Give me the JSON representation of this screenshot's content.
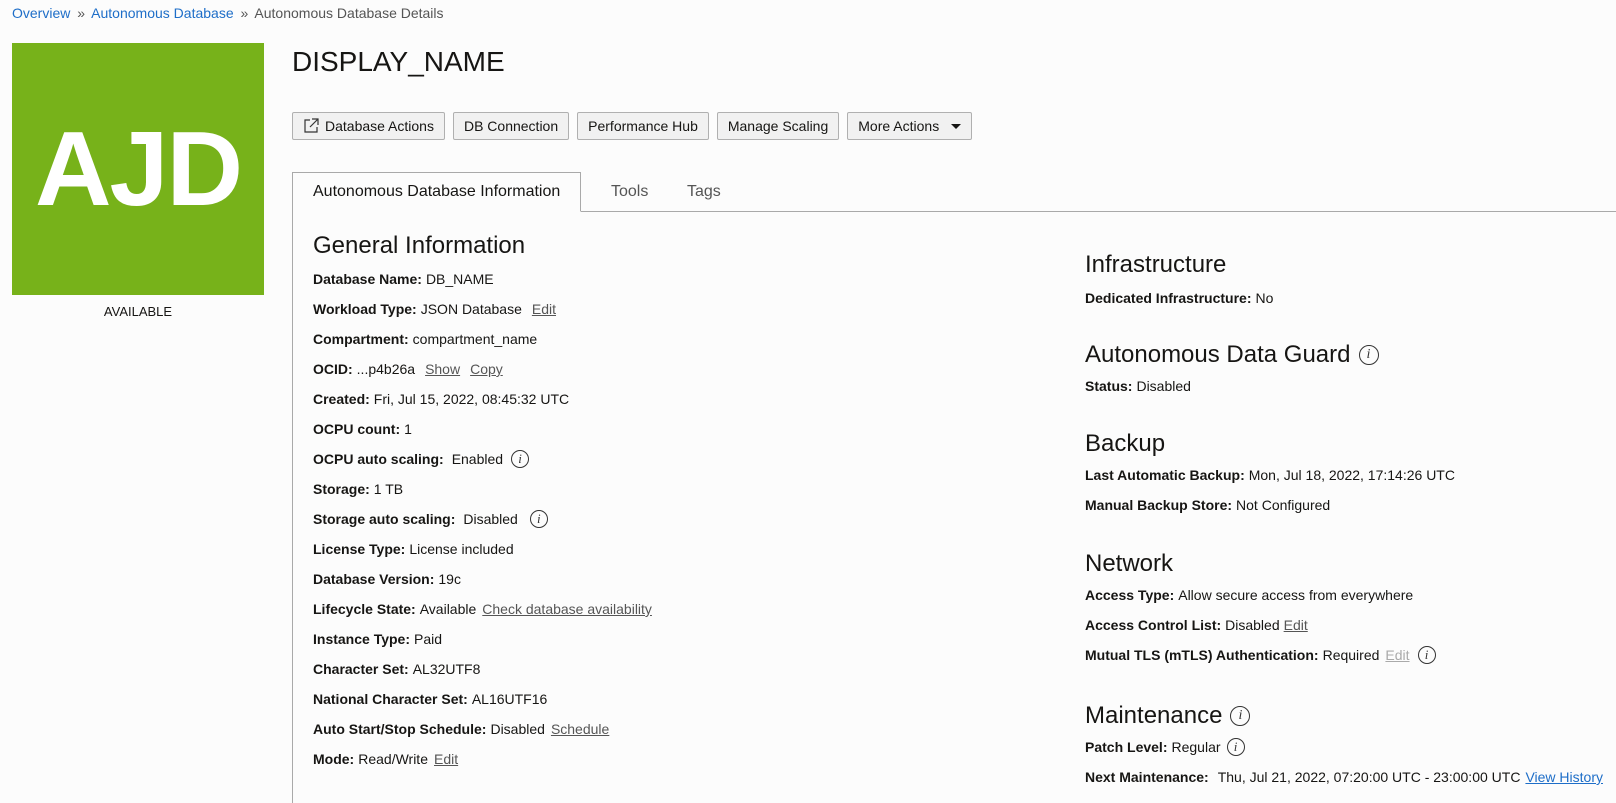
{
  "breadcrumb": {
    "items": [
      {
        "label": "Overview",
        "link": true
      },
      {
        "label": "Autonomous Database",
        "link": true
      },
      {
        "label": "Autonomous Database Details",
        "link": false
      }
    ],
    "separator": "»"
  },
  "logo": {
    "text": "AJD",
    "status": "AVAILABLE",
    "color": "#77b21a"
  },
  "header": {
    "title": "DISPLAY_NAME"
  },
  "toolbar": {
    "database_actions": "Database Actions",
    "db_connection": "DB Connection",
    "performance_hub": "Performance Hub",
    "manage_scaling": "Manage Scaling",
    "more_actions": "More Actions"
  },
  "tabs": [
    {
      "label": "Autonomous Database Information",
      "active": true
    },
    {
      "label": "Tools",
      "active": false
    },
    {
      "label": "Tags",
      "active": false
    }
  ],
  "general": {
    "title": "General Information",
    "database_name": {
      "label": "Database Name:",
      "value": "DB_NAME"
    },
    "workload_type": {
      "label": "Workload Type:",
      "value": "JSON Database",
      "action": "Edit"
    },
    "compartment": {
      "label": "Compartment:",
      "value": "compartment_name"
    },
    "ocid": {
      "label": "OCID:",
      "value": "...p4b26a",
      "show": "Show",
      "copy": "Copy"
    },
    "created": {
      "label": "Created:",
      "value": "Fri, Jul 15, 2022, 08:45:32 UTC"
    },
    "ocpu_count": {
      "label": "OCPU count:",
      "value": "1"
    },
    "ocpu_auto_scaling": {
      "label": "OCPU auto scaling:",
      "value": "Enabled"
    },
    "storage": {
      "label": "Storage:",
      "value": "1 TB"
    },
    "storage_auto_scaling": {
      "label": "Storage auto scaling:",
      "value": "Disabled"
    },
    "license_type": {
      "label": "License Type:",
      "value": "License included"
    },
    "database_version": {
      "label": "Database Version:",
      "value": "19c"
    },
    "lifecycle_state": {
      "label": "Lifecycle State:",
      "value": "Available",
      "action": "Check database availability"
    },
    "instance_type": {
      "label": "Instance Type:",
      "value": "Paid"
    },
    "character_set": {
      "label": "Character Set:",
      "value": "AL32UTF8"
    },
    "national_character_set": {
      "label": "National Character Set:",
      "value": "AL16UTF16"
    },
    "auto_start_stop": {
      "label": "Auto Start/Stop Schedule:",
      "value": "Disabled",
      "action": "Schedule"
    },
    "mode": {
      "label": "Mode:",
      "value": "Read/Write",
      "action": "Edit"
    }
  },
  "infrastructure": {
    "title": "Infrastructure",
    "dedicated": {
      "label": "Dedicated Infrastructure:",
      "value": "No"
    }
  },
  "data_guard": {
    "title": "Autonomous Data Guard",
    "status": {
      "label": "Status:",
      "value": "Disabled"
    }
  },
  "backup": {
    "title": "Backup",
    "last_automatic": {
      "label": "Last Automatic Backup:",
      "value": "Mon, Jul 18, 2022, 17:14:26 UTC"
    },
    "manual_store": {
      "label": "Manual Backup Store:",
      "value": "Not Configured"
    }
  },
  "network": {
    "title": "Network",
    "access_type": {
      "label": "Access Type:",
      "value": "Allow secure access from everywhere"
    },
    "acl": {
      "label": "Access Control List:",
      "value": "Disabled",
      "action": "Edit"
    },
    "mtls": {
      "label": "Mutual TLS (mTLS) Authentication:",
      "value": "Required",
      "action": "Edit"
    }
  },
  "maintenance": {
    "title": "Maintenance",
    "patch_level": {
      "label": "Patch Level:",
      "value": "Regular"
    },
    "next": {
      "label": "Next Maintenance:",
      "value": "Thu, Jul 21, 2022, 07:20:00 UTC - 23:00:00 UTC",
      "action": "View History"
    }
  },
  "icons": {
    "info": "i"
  }
}
